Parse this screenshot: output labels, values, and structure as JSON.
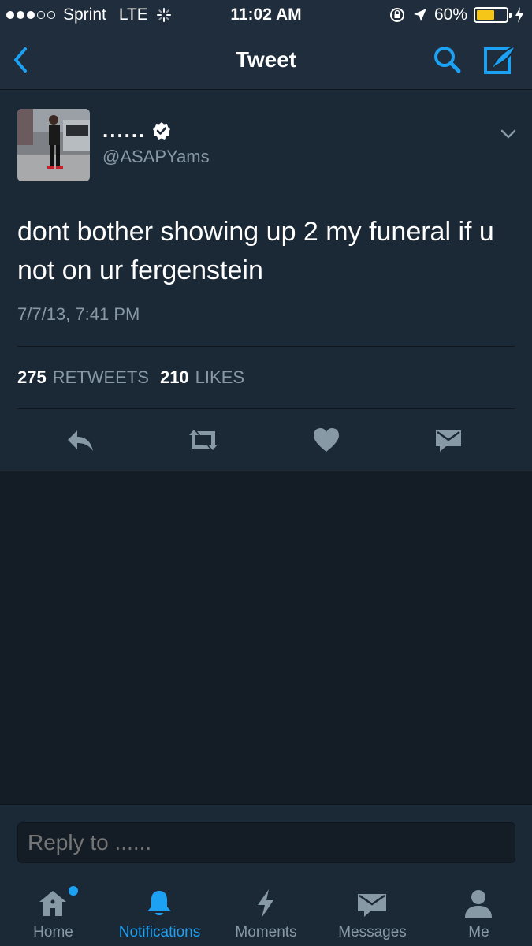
{
  "status_bar": {
    "carrier": "Sprint",
    "network": "LTE",
    "time": "11:02 AM",
    "battery_percent": "60%",
    "battery_level": 0.6
  },
  "nav": {
    "title": "Tweet"
  },
  "tweet": {
    "display_name": "......",
    "handle": "@ASAPYams",
    "text": "dont bother showing up 2 my funeral if u not on ur fergenstein",
    "timestamp": "7/7/13, 7:41 PM",
    "retweets_count": "275",
    "retweets_label": "RETWEETS",
    "likes_count": "210",
    "likes_label": "LIKES"
  },
  "reply": {
    "placeholder": "Reply to ......"
  },
  "tabs": [
    {
      "label": "Home",
      "icon": "home-icon"
    },
    {
      "label": "Notifications",
      "icon": "bell-icon"
    },
    {
      "label": "Moments",
      "icon": "lightning-icon"
    },
    {
      "label": "Messages",
      "icon": "envelope-icon"
    },
    {
      "label": "Me",
      "icon": "person-icon"
    }
  ],
  "colors": {
    "accent": "#1da1f2",
    "background": "#141d26",
    "card": "#1b2836",
    "secondary_text": "#8899a6"
  }
}
